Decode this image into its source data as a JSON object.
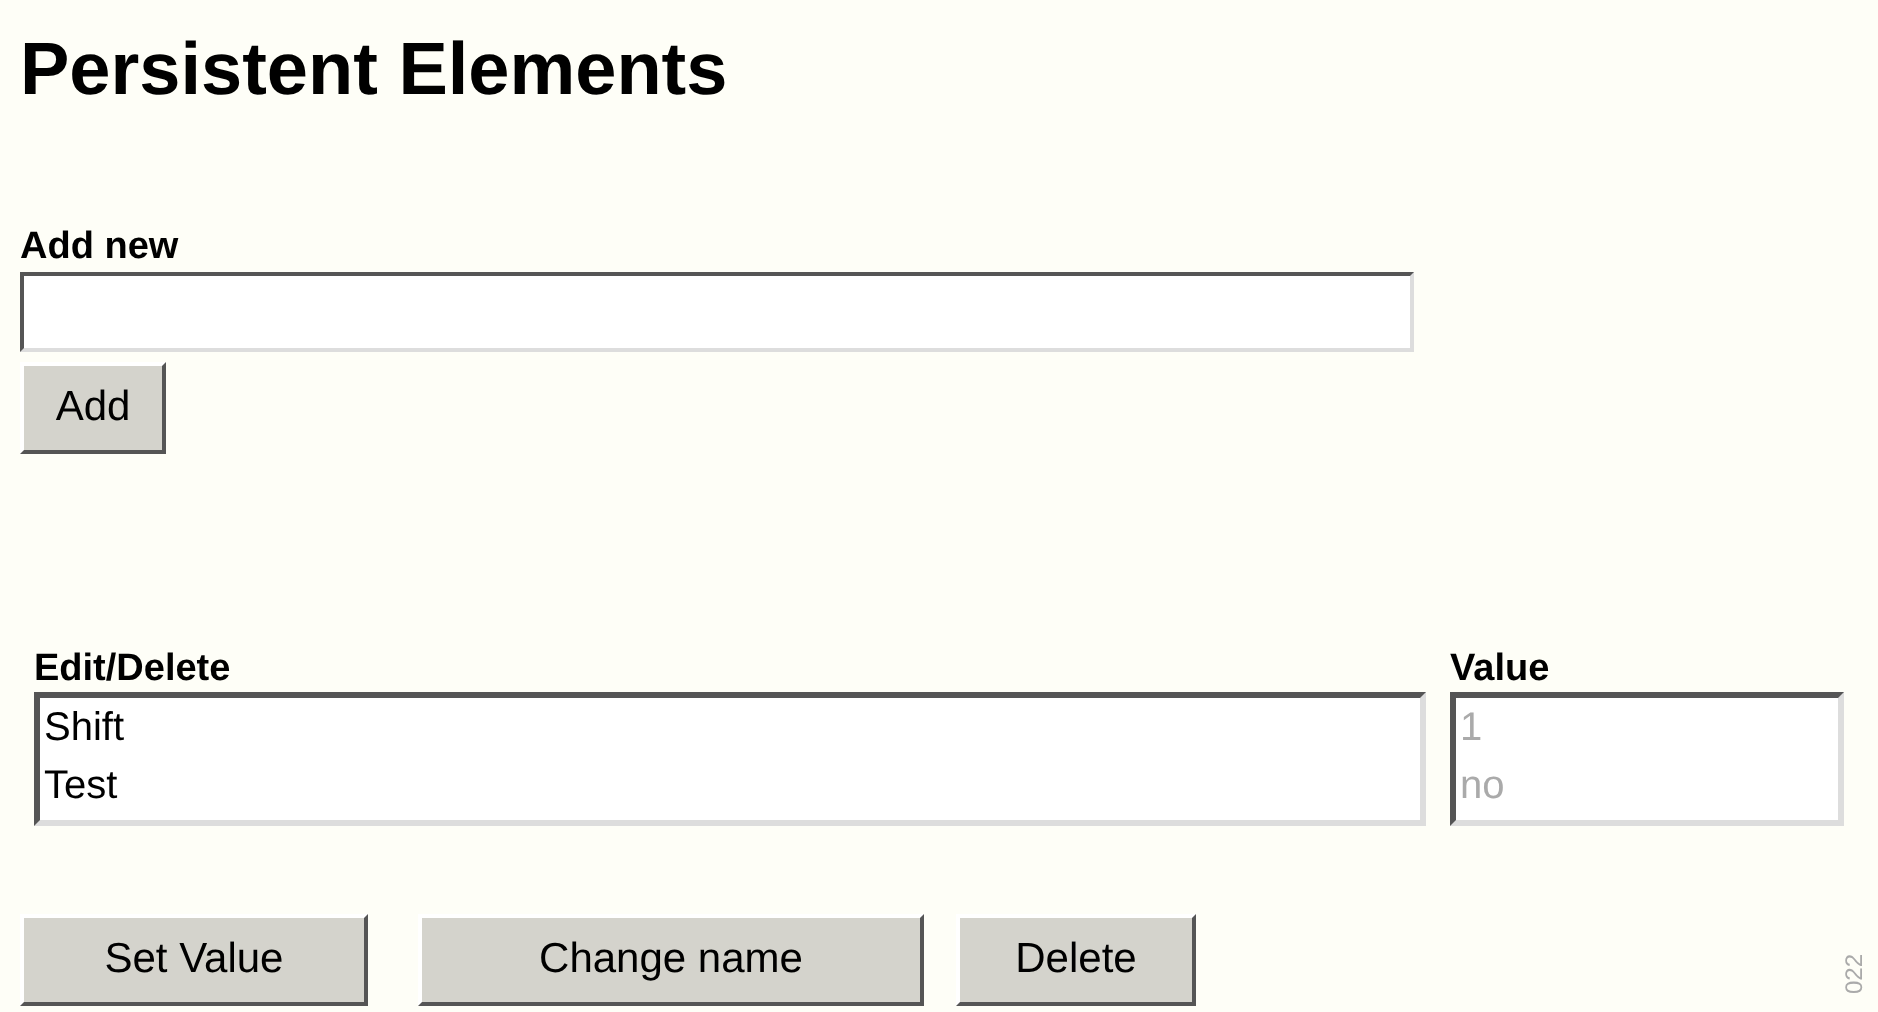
{
  "title": "Persistent Elements",
  "add_new": {
    "label": "Add new",
    "button": "Add"
  },
  "edit_delete": {
    "label": "Edit/Delete",
    "items": [
      "Shift",
      "Test"
    ]
  },
  "value": {
    "label": "Value",
    "disabled": true,
    "items": [
      "1",
      "no"
    ]
  },
  "buttons": [
    "Set Value",
    "Change name",
    "Delete"
  ],
  "figure_number": "022"
}
